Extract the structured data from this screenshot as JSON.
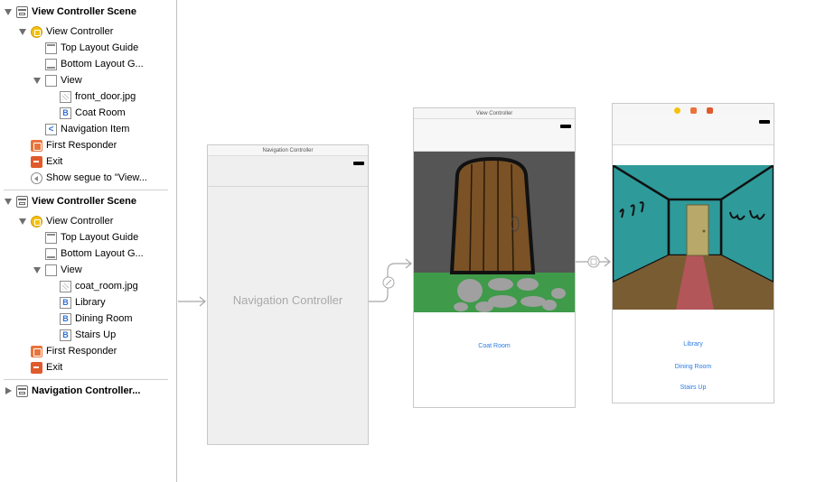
{
  "outline": {
    "rows": [
      {
        "label": "View Controller Scene",
        "icon": "scene-icon"
      },
      {
        "label": "View Controller",
        "icon": "view-controller-icon"
      },
      {
        "label": "Top Layout Guide",
        "icon": "layout-guide-icon"
      },
      {
        "label": "Bottom Layout G...",
        "icon": "layout-guide-icon"
      },
      {
        "label": "View",
        "icon": "view-icon"
      },
      {
        "label": "front_door.jpg",
        "icon": "image-view-icon"
      },
      {
        "label": "Coat Room",
        "icon": "button-icon"
      },
      {
        "label": "Navigation Item",
        "icon": "navigation-item-icon"
      },
      {
        "label": "First Responder",
        "icon": "first-responder-icon"
      },
      {
        "label": "Exit",
        "icon": "exit-icon"
      },
      {
        "label": "Show segue to \"View...",
        "icon": "segue-icon"
      },
      {
        "label": "View Controller Scene",
        "icon": "scene-icon"
      },
      {
        "label": "View Controller",
        "icon": "view-controller-icon"
      },
      {
        "label": "Top Layout Guide",
        "icon": "layout-guide-icon"
      },
      {
        "label": "Bottom Layout G...",
        "icon": "layout-guide-icon"
      },
      {
        "label": "View",
        "icon": "view-icon"
      },
      {
        "label": "coat_room.jpg",
        "icon": "image-view-icon"
      },
      {
        "label": "Library",
        "icon": "button-icon"
      },
      {
        "label": "Dining Room",
        "icon": "button-icon"
      },
      {
        "label": "Stairs Up",
        "icon": "button-icon"
      },
      {
        "label": "First Responder",
        "icon": "first-responder-icon"
      },
      {
        "label": "Exit",
        "icon": "exit-icon"
      },
      {
        "label": "Navigation Controller...",
        "icon": "scene-icon"
      }
    ],
    "button_glyph": "B",
    "nav_glyph": "<"
  },
  "canvas": {
    "nav_controller": {
      "title": "Navigation Controller",
      "placeholder": "Navigation Controller"
    },
    "front_door_vc": {
      "title": "View Controller",
      "button": "Coat Room"
    },
    "coat_room_vc": {
      "buttons": [
        "Library",
        "Dining Room",
        "Stairs Up"
      ]
    }
  },
  "colors": {
    "accent_blue": "#2b7be4",
    "door_bg": "#555555",
    "grass": "#3f9a4a",
    "room_wall": "#2f9a9a",
    "room_floor": "#7a5c32"
  }
}
